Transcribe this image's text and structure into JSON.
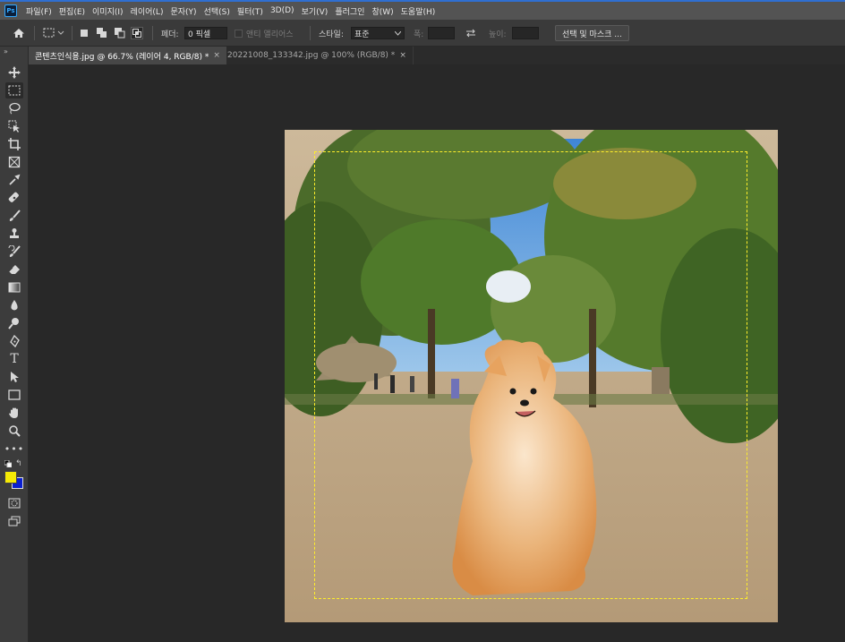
{
  "app": {
    "logo_text": "Ps"
  },
  "menu": {
    "items": [
      "파일(F)",
      "편집(E)",
      "이미지(I)",
      "레이어(L)",
      "문자(Y)",
      "선택(S)",
      "필터(T)",
      "3D(D)",
      "보기(V)",
      "플러그인",
      "창(W)",
      "도움말(H)"
    ]
  },
  "options": {
    "feather_label": "페더:",
    "feather_value": "0 픽셀",
    "antialias_label": "앤티 앨리어스",
    "style_label": "스타일:",
    "style_value": "표준",
    "width_label": "폭:",
    "height_label": "높이:",
    "select_mask_button": "선택 및 마스크 ..."
  },
  "tabs": [
    {
      "label": "콘텐츠인식용.jpg @ 66.7% (레이어 4, RGB/8) *",
      "close": "×"
    },
    {
      "label": "20221008_133342.jpg @ 100% (RGB/8) *",
      "close": "×"
    }
  ],
  "colors": {
    "foreground": "#f5ea05",
    "background": "#0a1fd0",
    "marquee": "#ffef2a",
    "accent": "#31a8ff"
  },
  "toolbar_icons": [
    "move-icon",
    "rect-marquee-icon",
    "lasso-icon",
    "object-select-icon",
    "crop-icon",
    "frame-icon",
    "eyedropper-icon",
    "healing-brush-icon",
    "brush-icon",
    "clone-stamp-icon",
    "history-brush-icon",
    "eraser-icon",
    "gradient-icon",
    "blur-icon",
    "dodge-icon",
    "pen-icon",
    "type-icon",
    "path-select-icon",
    "rectangle-shape-icon",
    "hand-icon",
    "zoom-icon",
    "more-tools-icon"
  ]
}
